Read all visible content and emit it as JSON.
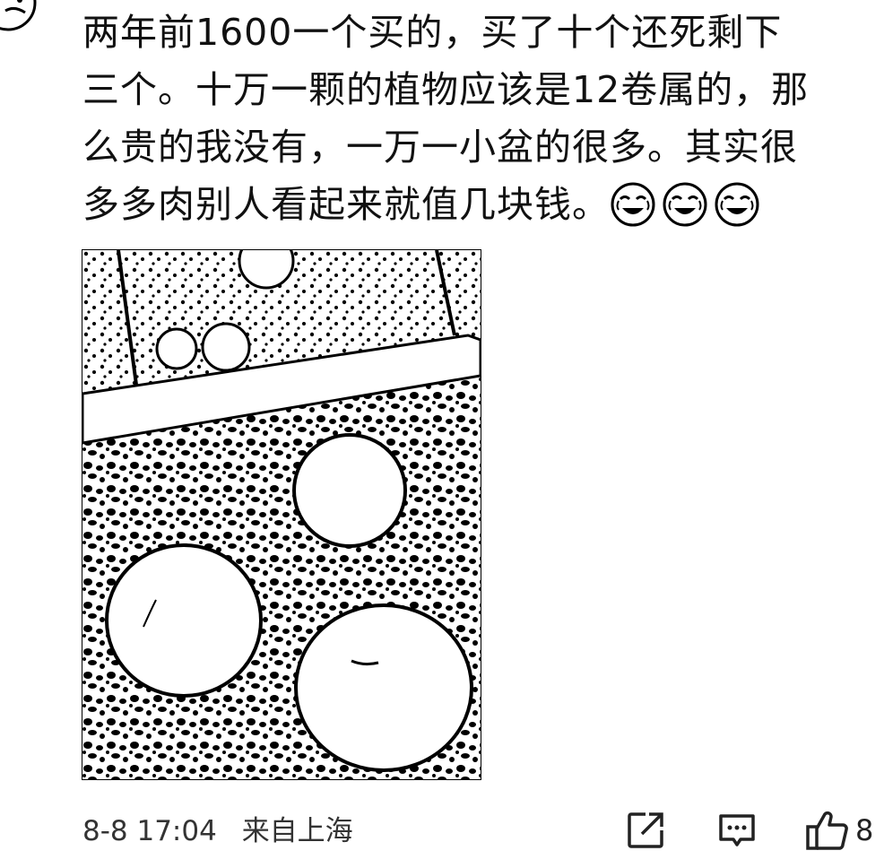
{
  "comment": {
    "lines": [
      "两年前1600一个买的，买了十个还死剩下",
      "三个。十万一颗的植物应该是12卷属的，那",
      "么贵的我没有，一万一小盆的很多。其实很",
      "多多肉别人看起来就值几块钱。"
    ],
    "emojis": [
      "laugh-cry-emoji",
      "laugh-cry-emoji",
      "laugh-cry-emoji"
    ]
  },
  "photo": {
    "subject": "three round succulents in gravel pot"
  },
  "footer": {
    "time": "8-8 17:04",
    "location": "来自上海",
    "like_count": "8"
  },
  "icons": {
    "share": "share-icon",
    "reply": "reply-icon",
    "like": "thumbs-up-icon"
  },
  "colors": {
    "text": "#111111",
    "meta": "#333333",
    "background": "#ffffff"
  }
}
